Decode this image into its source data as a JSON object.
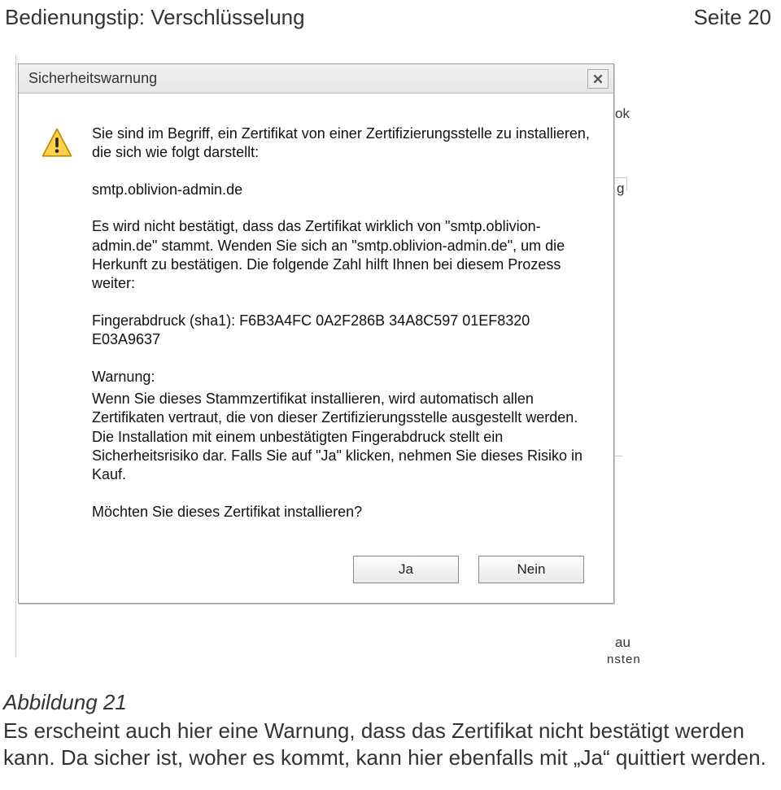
{
  "header": {
    "title_left": "Bedienungstip: Verschlüsselung",
    "title_right": "Seite 20"
  },
  "bg": {
    "frag1": "ok",
    "frag2": "g",
    "frag3": "au",
    "frag4": "nsten"
  },
  "dialog": {
    "title": "Sicherheitswarnung",
    "p1": "Sie sind im Begriff, ein Zertifikat von einer Zertifizierungsstelle zu installieren, die sich wie folgt darstellt:",
    "host": "smtp.oblivion-admin.de",
    "p2": "Es wird nicht bestätigt, dass das Zertifikat wirklich von \"smtp.oblivion-admin.de\" stammt. Wenden Sie sich an \"smtp.oblivion-admin.de\", um die Herkunft zu bestätigen. Die folgende Zahl hilft Ihnen bei diesem Prozess weiter:",
    "fingerprint": "Fingerabdruck (sha1): F6B3A4FC 0A2F286B 34A8C597 01EF8320 E03A9637",
    "warn_label": "Warnung:",
    "warn_body": "Wenn Sie dieses Stammzertifikat installieren, wird automatisch allen Zertifikaten vertraut, die von dieser Zertifizierungsstelle ausgestellt werden. Die Installation mit einem unbestätigten Fingerabdruck stellt ein Sicherheitsrisiko dar. Falls Sie auf \"Ja\" klicken, nehmen Sie dieses Risiko in Kauf.",
    "confirm": "Möchten Sie dieses Zertifikat installieren?",
    "btn_yes": "Ja",
    "btn_no": "Nein"
  },
  "caption": {
    "figure": "Abbildung 21",
    "text": "Es erscheint auch hier eine Warnung, dass das Zertifikat nicht bestätigt werden kann. Da sicher ist, woher es kommt, kann hier ebenfalls mit „Ja“ quittiert werden."
  }
}
